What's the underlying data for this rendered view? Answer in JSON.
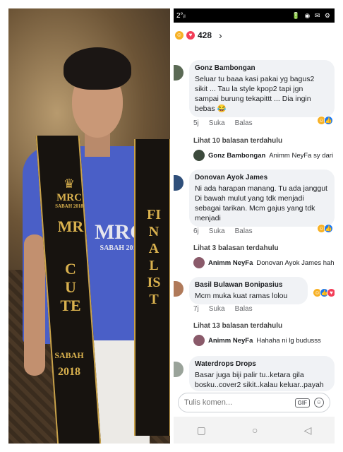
{
  "photo": {
    "sash_mrc": "MRC",
    "sash_sabah": "SABAH 2018",
    "sash_mr": "MR",
    "sash_cute": "CUTE",
    "sash_sabah_bottom": "SABAH",
    "sash_year": "2018",
    "sash_finalist": "FINALIST",
    "shirt_logo_big": "MRC",
    "shirt_logo_small": "SABAH 2018"
  },
  "statusbar": {
    "left": "2°",
    "signal": "ᵢₗ",
    "right_icons": "🔋 ◉ ✉ ⚙"
  },
  "header": {
    "reaction_count": "428",
    "chevron": "›"
  },
  "comments": [
    {
      "author": "Gonz Bambongan",
      "text": "Seluar tu baaa kasi pakai yg bagus2 sikit ... Tau la style kpop2 tapi jgn sampai burung tekapittt ... Dia ingin bebas 😂",
      "time": "5j",
      "like": "Suka",
      "reply": "Balas",
      "more_replies": "Lihat 10 balasan terdahulu",
      "reply_author": "Gonz Bambongan",
      "reply_text": "Animm NeyFa sy dari"
    },
    {
      "author": "Donovan Ayok James",
      "text": "Ni ada harapan manang. Tu ada janggut Di bawah mulut yang tdk menjadi sebagai tarikan. Mcm gajus yang tdk menjadi",
      "time": "6j",
      "like": "Suka",
      "reply": "Balas",
      "more_replies": "Lihat 3 balasan terdahulu",
      "reply_author": "Animm NeyFa",
      "reply_text": "Donovan Ayok James hah"
    },
    {
      "author": "Basil Bulawan Bonipasius",
      "text": "Mcm muka kuat ramas lolou",
      "time": "7j",
      "like": "Suka",
      "reply": "Balas",
      "more_replies": "Lihat 13 balasan terdahulu",
      "reply_author": "Animm NeyFa",
      "reply_text": "Hahaha ni lg budusss"
    },
    {
      "author": "Waterdrops Drops",
      "text": "Basar juga biji palir tu..ketara gila bosku..cover2 sikit..kalau keluar..payah"
    }
  ],
  "composer": {
    "placeholder": "Tulis komen...",
    "gif": "GIF",
    "emoji": "☺"
  },
  "navbar": {
    "recents": "▢",
    "home": "○",
    "back": "◁"
  },
  "colors": {
    "like_blue": "#1877f2",
    "heart_red": "#f33e58",
    "haha_yellow": "#f7b125",
    "bubble_gray": "#f0f2f5"
  }
}
